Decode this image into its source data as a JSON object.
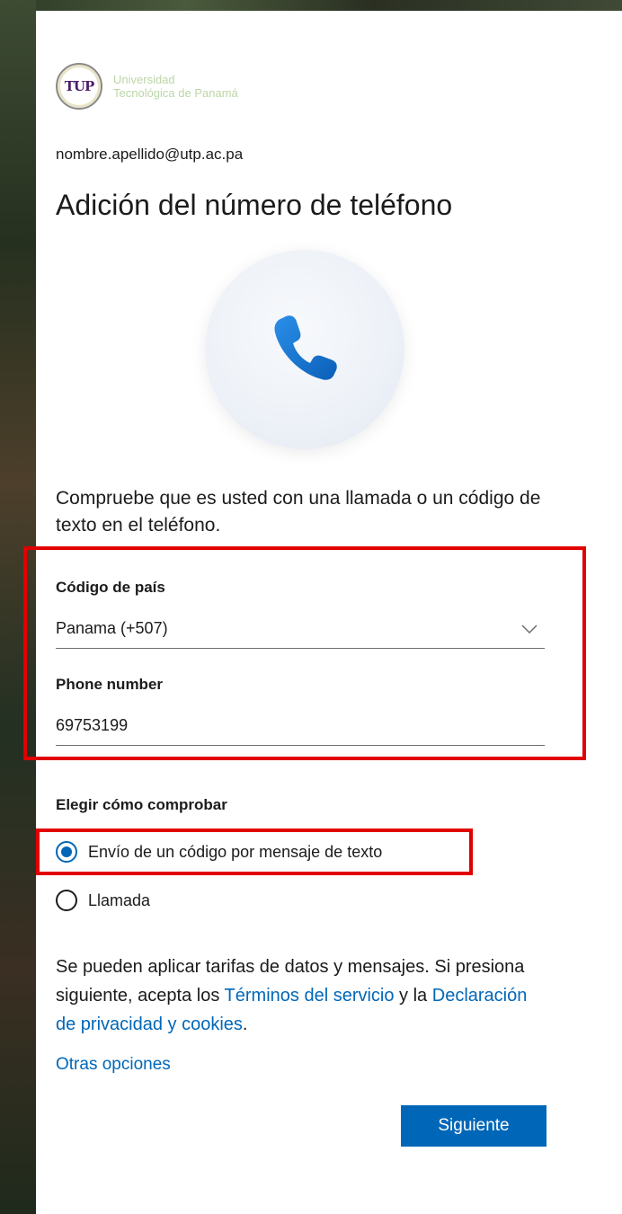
{
  "header": {
    "logo_monogram": "TUP",
    "logo_name_line1": "Universidad",
    "logo_name_line2": "Tecnológica de Panamá",
    "account_email": "nombre.apellido@utp.ac.pa",
    "title": "Adición del número de teléfono"
  },
  "intro_text": "Compruebe que es usted con una llamada o un código de texto en el teléfono.",
  "country": {
    "label": "Código de país",
    "selected": "Panama (+507)",
    "icon": "chevron-down-icon"
  },
  "phone": {
    "label": "Phone number",
    "value": "69753199"
  },
  "method": {
    "label": "Elegir cómo comprobar",
    "options": [
      {
        "label": "Envío de un código por mensaje de texto",
        "checked": true
      },
      {
        "label": "Llamada",
        "checked": false
      }
    ]
  },
  "notice": {
    "part1": "Se pueden aplicar tarifas de datos y mensajes. Si presiona siguiente, acepta los ",
    "terms_link": "Términos del servicio",
    "part2": " y la ",
    "privacy_link": "Declaración de privacidad y cookies",
    "part3": "."
  },
  "other_options": "Otras opciones",
  "next_button": "Siguiente",
  "colors": {
    "accent": "#0067b8",
    "highlight": "#e00000"
  }
}
